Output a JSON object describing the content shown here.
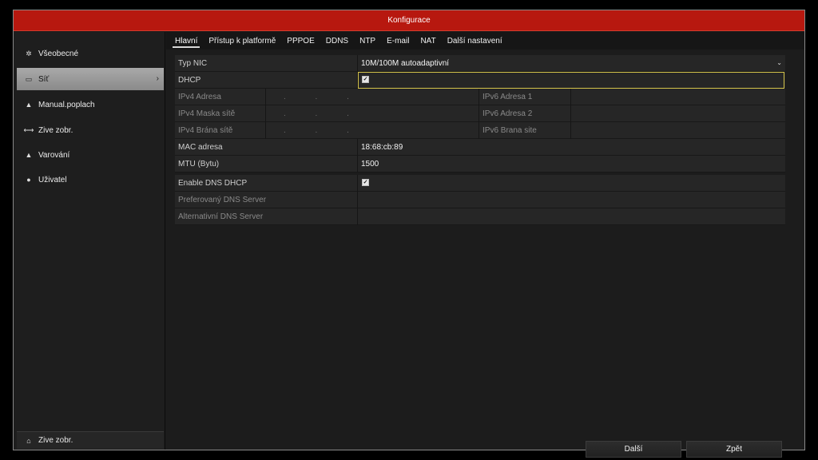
{
  "window": {
    "title": "Konfigurace"
  },
  "sidebar": {
    "items": [
      {
        "label": "Všeobecné",
        "icon": "gear-icon"
      },
      {
        "label": "Síť",
        "icon": "network-icon",
        "active": true
      },
      {
        "label": "Manual.poplach",
        "icon": "alarm-icon"
      },
      {
        "label": "Zive zobr.",
        "icon": "live-view-icon"
      },
      {
        "label": "Varování",
        "icon": "warning-icon"
      },
      {
        "label": "Uživatel",
        "icon": "user-icon"
      }
    ],
    "bottom": {
      "label": "Zive zobr.",
      "icon": "home-icon"
    }
  },
  "tabs": [
    "Hlavní",
    "Přístup k platformě",
    "PPPOE",
    "DDNS",
    "NTP",
    "E-mail",
    "NAT",
    "Další nastavení"
  ],
  "form": {
    "nic_type": {
      "label": "Typ NIC",
      "value": "10M/100M autoadaptivní"
    },
    "dhcp": {
      "label": "DHCP",
      "checked": true
    },
    "ipv4_address": {
      "label": "IPv4 Adresa",
      "value": ". . ."
    },
    "ipv4_mask": {
      "label": "IPv4 Maska sítě",
      "value": ". . ."
    },
    "ipv4_gateway": {
      "label": "IPv4 Brána sítě",
      "value": ". . ."
    },
    "ipv6_address1": {
      "label": "IPv6 Adresa 1",
      "value": ""
    },
    "ipv6_address2": {
      "label": "IPv6 Adresa 2",
      "value": ""
    },
    "ipv6_gateway": {
      "label": "IPv6 Brana site",
      "value": ""
    },
    "mac": {
      "label": "MAC adresa",
      "value": "18:68:cb:89"
    },
    "mtu": {
      "label": "MTU (Bytu)",
      "value": "1500"
    },
    "dns_dhcp": {
      "label": "Enable DNS DHCP",
      "checked": true
    },
    "dns_preferred": {
      "label": "Preferovaný DNS Server",
      "value": ""
    },
    "dns_alternate": {
      "label": "Alternativní DNS Server",
      "value": ""
    }
  },
  "buttons": {
    "next": "Další",
    "back": "Zpět"
  },
  "colors": {
    "titlebar": "#b7180f",
    "focus": "#d4c34a"
  }
}
